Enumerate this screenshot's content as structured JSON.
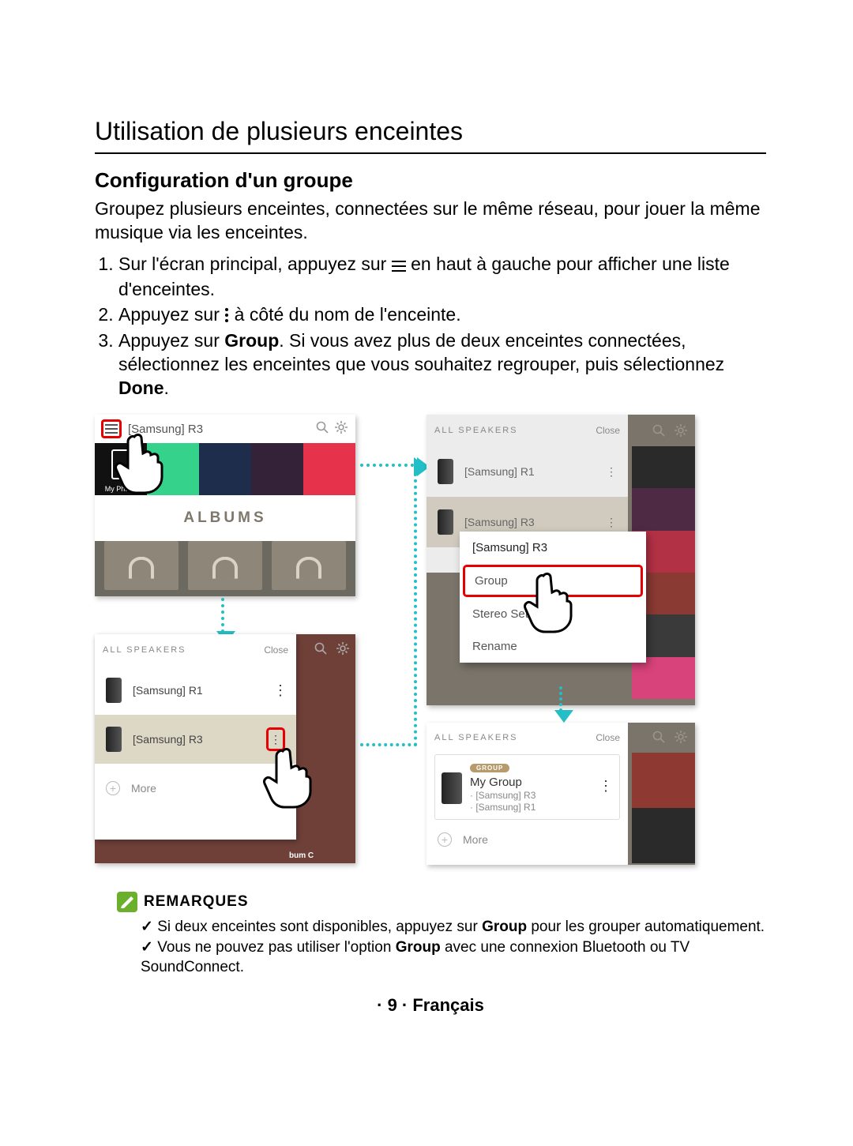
{
  "page": {
    "title": "Utilisation de plusieurs enceintes",
    "subtitle": "Configuration d'un groupe",
    "intro": "Groupez plusieurs enceintes, connectées sur le même réseau, pour jouer la même musique via les enceintes."
  },
  "steps": {
    "s1a": "Sur l'écran principal, appuyez sur ",
    "s1b": " en haut à gauche pour afficher une liste d'enceintes.",
    "s2a": "Appuyez sur ",
    "s2b": " à côté du nom de l'enceinte.",
    "s3a": "Appuyez sur ",
    "s3bold1": "Group",
    "s3b": ". Si vous avez plus de deux enceintes connectées, sélectionnez les enceintes que vous souhaitez regrouper, puis sélectionnez ",
    "s3bold2": "Done",
    "s3c": "."
  },
  "panel1": {
    "title": "[Samsung] R3",
    "myphone": "My Phone",
    "albums": "ALBUMS"
  },
  "panel2": {
    "header": "ALL SPEAKERS",
    "close": "Close",
    "r1": "[Samsung] R1",
    "r3": "[Samsung] R3",
    "more": "More",
    "bum": "bum C"
  },
  "panel3": {
    "header": "ALL SPEAKERS",
    "close": "Close",
    "r1": "[Samsung] R1",
    "r3": "[Samsung] R3",
    "menu": {
      "title": "[Samsung] R3",
      "group": "Group",
      "stereo": "Stereo Set",
      "rename": "Rename"
    }
  },
  "panel4": {
    "header": "ALL SPEAKERS",
    "close": "Close",
    "badge": "GROUP",
    "groupname": "My Group",
    "sub1": "· [Samsung] R3",
    "sub2": "· [Samsung] R1",
    "more": "More"
  },
  "notes": {
    "title": "REMARQUES",
    "n1a": "Si deux enceintes sont disponibles, appuyez sur ",
    "n1bold": "Group",
    "n1b": " pour les grouper automatiquement.",
    "n2a": "Vous ne pouvez pas utiliser l'option ",
    "n2bold": "Group",
    "n2b": " avec une connexion Bluetooth ou TV SoundConnect."
  },
  "footer": "· 9 · Français"
}
